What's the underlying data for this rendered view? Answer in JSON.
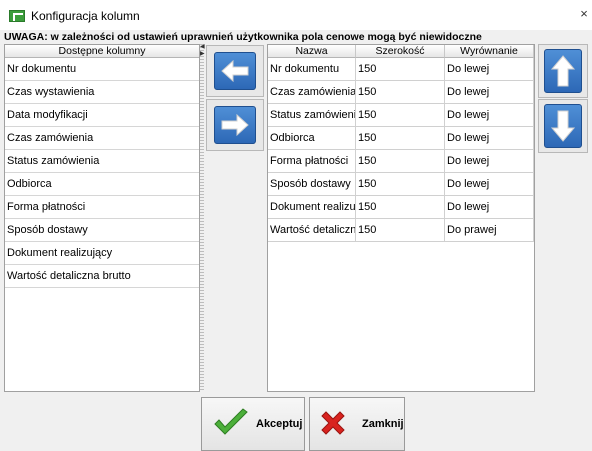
{
  "window": {
    "title": "Konfiguracja kolumn",
    "close_glyph": "×"
  },
  "warning": "UWAGA: w zależności od ustawień uprawnień użytkownika pola cenowe mogą być niewidoczne",
  "available": {
    "header": "Dostępne kolumny",
    "items": [
      {
        "label": "Nr dokumentu"
      },
      {
        "label": "Czas wystawienia"
      },
      {
        "label": "Data modyfikacji"
      },
      {
        "label": "Czas zamówienia"
      },
      {
        "label": "Status zamówienia"
      },
      {
        "label": "Odbiorca"
      },
      {
        "label": "Forma płatności"
      },
      {
        "label": "Sposób dostawy"
      },
      {
        "label": "Dokument realizujący"
      },
      {
        "label": "Wartość detaliczna brutto"
      }
    ]
  },
  "selected": {
    "headers": [
      "Nazwa",
      "Szerokość",
      "Wyrównanie"
    ],
    "rows": [
      {
        "name": "Nr dokumentu",
        "width": "150",
        "align": "Do lewej"
      },
      {
        "name": "Czas zamówienia",
        "width": "150",
        "align": "Do lewej"
      },
      {
        "name": "Status zamówienia",
        "width": "150",
        "align": "Do lewej"
      },
      {
        "name": "Odbiorca",
        "width": "150",
        "align": "Do lewej"
      },
      {
        "name": "Forma płatności",
        "width": "150",
        "align": "Do lewej"
      },
      {
        "name": "Sposób dostawy",
        "width": "150",
        "align": "Do lewej"
      },
      {
        "name": "Dokument realizuj...",
        "width": "150",
        "align": "Do lewej"
      },
      {
        "name": "Wartość detaliczna...",
        "width": "150",
        "align": "Do prawej"
      }
    ]
  },
  "buttons": {
    "accept": "Akceptuj",
    "close": "Zamknij"
  },
  "icons": {
    "move_left": "arrow-left-icon",
    "move_right": "arrow-right-icon",
    "move_up": "arrow-up-icon",
    "move_down": "arrow-down-icon",
    "accept": "checkmark-icon",
    "close": "red-x-icon"
  },
  "colors": {
    "accent_blue": "#2d68b6",
    "check_green": "#4caf3a",
    "close_red": "#d9231f"
  }
}
